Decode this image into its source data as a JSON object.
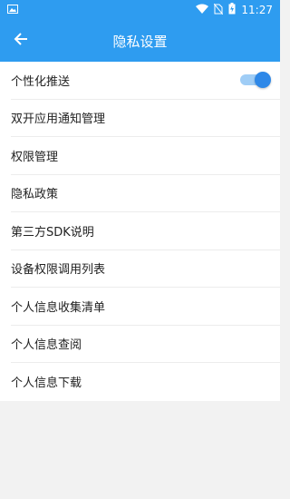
{
  "status_bar": {
    "time": "11:27",
    "icons": [
      "image-icon",
      "wifi-icon",
      "no-sim-icon",
      "battery-charging-icon"
    ]
  },
  "app_bar": {
    "title": "隐私设置",
    "back_icon": "arrow-left-icon"
  },
  "settings": {
    "items": [
      {
        "label": "个性化推送",
        "toggle": true
      },
      {
        "label": "双开应用通知管理"
      },
      {
        "label": "权限管理"
      },
      {
        "label": "隐私政策"
      },
      {
        "label": "第三方SDK说明"
      },
      {
        "label": "设备权限调用列表"
      },
      {
        "label": "个人信息收集清单"
      },
      {
        "label": "个人信息查阅"
      },
      {
        "label": "个人信息下载"
      }
    ]
  },
  "colors": {
    "primary": "#2e9cf0",
    "toggle_thumb": "#2e88e8",
    "toggle_track": "#9fcdf6",
    "background": "#f2f2f2"
  }
}
